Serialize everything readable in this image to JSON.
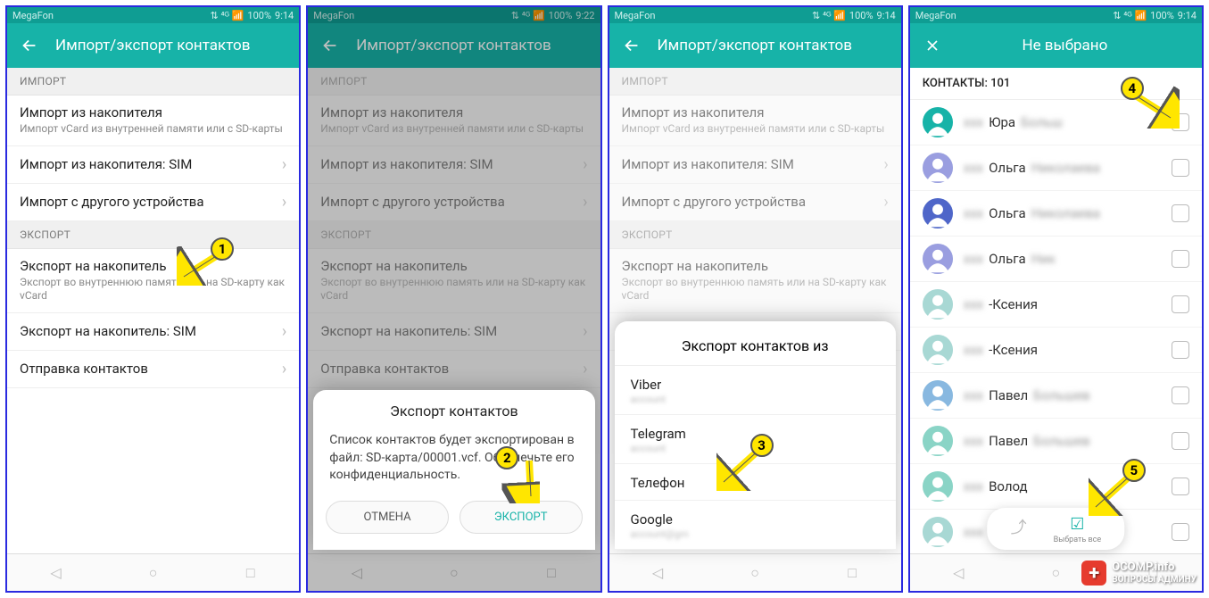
{
  "status": {
    "carrier": "MegaFon",
    "battery": "100%",
    "time1": "9:14",
    "time2": "9:22",
    "signal_icons": "⇅ ⁴ᴳ 📶"
  },
  "header": {
    "title": "Импорт/экспорт контактов",
    "title4": "Не выбрано"
  },
  "sections": {
    "import": "ИМПОРТ",
    "export": "ЭКСПОРТ"
  },
  "items": {
    "imp_storage": {
      "t": "Импорт из накопителя",
      "s": "Импорт vCard из внутренней памяти или с SD-карты"
    },
    "imp_sim": {
      "t": "Импорт из накопителя: SIM"
    },
    "imp_device": {
      "t": "Импорт с другого устройства"
    },
    "exp_storage": {
      "t": "Экспорт на накопитель",
      "s": "Экспорт во внутреннюю память или на SD-карту как vCard"
    },
    "exp_sim": {
      "t": "Экспорт на накопитель: SIM"
    },
    "send": {
      "t": "Отправка контактов"
    }
  },
  "dialog": {
    "title": "Экспорт контактов",
    "body": "Список контактов будет экспортирован в файл: SD-карта/00001.vcf. Обеспечьте его конфиденциальность.",
    "cancel": "ОТМЕНА",
    "ok": "ЭКСПОРТ"
  },
  "sheet": {
    "title": "Экспорт контактов из",
    "opts": [
      "Viber",
      "Telegram",
      "Телефон",
      "Google"
    ]
  },
  "contacts": {
    "count_label": "КОНТАКТЫ: 101",
    "rows": [
      {
        "name": "Юра",
        "last": "Больш",
        "color": "#17b3a8"
      },
      {
        "name": "Ольга",
        "last": "Николаева",
        "color": "#9a9ee0"
      },
      {
        "name": "Ольга",
        "last": "Николаева",
        "color": "#4f66c9"
      },
      {
        "name": "Ольга",
        "last": "Ник",
        "color": "#9a9ee0"
      },
      {
        "name": "-Ксения",
        "last": "",
        "color": "#a8d8d4"
      },
      {
        "name": "-Ксения",
        "last": "",
        "color": "#a8d8d4"
      },
      {
        "name": "Павел",
        "last": "Большев",
        "color": "#88b8e0"
      },
      {
        "name": "Павел",
        "last": "Большев",
        "color": "#8ad4c6"
      },
      {
        "name": "Волод",
        "last": "",
        "color": "#8ad4c6"
      },
      {
        "name": "",
        "last": "",
        "color": "#a8d8d4"
      }
    ],
    "select_all": "Выбрать все"
  },
  "callouts": {
    "n1": "1",
    "n2": "2",
    "n3": "3",
    "n4": "4",
    "n5": "5"
  },
  "watermark": {
    "brand1": "OCOMP.info",
    "brand2": "ВОПРОСЫ АДМИНУ"
  }
}
